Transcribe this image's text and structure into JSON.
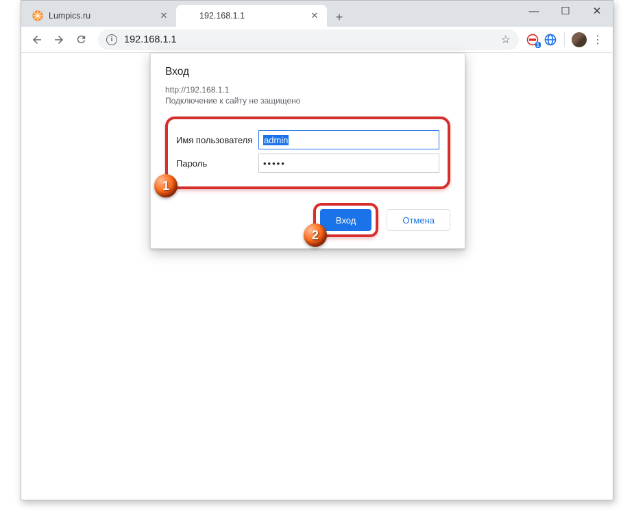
{
  "window": {
    "minimize": "—",
    "maximize": "☐",
    "close": "✕"
  },
  "tabs": [
    {
      "title": "Lumpics.ru",
      "favicon": "orange-slice"
    },
    {
      "title": "192.168.1.1",
      "favicon": "none"
    }
  ],
  "new_tab": "+",
  "toolbar": {
    "info": "i",
    "address": "192.168.1.1"
  },
  "extensions": {
    "badge_count": "1"
  },
  "dialog": {
    "title": "Вход",
    "url": "http://192.168.1.1",
    "warning": "Подключение к сайту не защищено",
    "username_label": "Имя пользователя",
    "username_value": "admin",
    "password_label": "Пароль",
    "password_value": "•••••",
    "login_button": "Вход",
    "cancel_button": "Отмена"
  },
  "annotations": {
    "badge1": "1",
    "badge2": "2"
  }
}
